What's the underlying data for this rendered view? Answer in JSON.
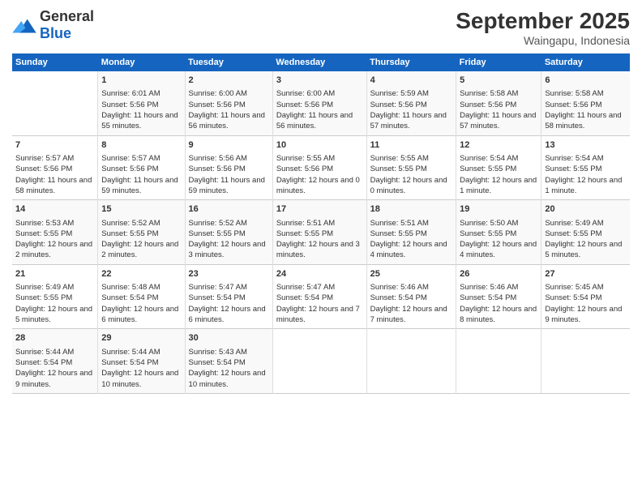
{
  "header": {
    "logo_general": "General",
    "logo_blue": "Blue",
    "title": "September 2025",
    "subtitle": "Waingapu, Indonesia"
  },
  "columns": [
    "Sunday",
    "Monday",
    "Tuesday",
    "Wednesday",
    "Thursday",
    "Friday",
    "Saturday"
  ],
  "weeks": [
    [
      {
        "day": "",
        "sunrise": "",
        "sunset": "",
        "daylight": ""
      },
      {
        "day": "1",
        "sunrise": "Sunrise: 6:01 AM",
        "sunset": "Sunset: 5:56 PM",
        "daylight": "Daylight: 11 hours and 55 minutes."
      },
      {
        "day": "2",
        "sunrise": "Sunrise: 6:00 AM",
        "sunset": "Sunset: 5:56 PM",
        "daylight": "Daylight: 11 hours and 56 minutes."
      },
      {
        "day": "3",
        "sunrise": "Sunrise: 6:00 AM",
        "sunset": "Sunset: 5:56 PM",
        "daylight": "Daylight: 11 hours and 56 minutes."
      },
      {
        "day": "4",
        "sunrise": "Sunrise: 5:59 AM",
        "sunset": "Sunset: 5:56 PM",
        "daylight": "Daylight: 11 hours and 57 minutes."
      },
      {
        "day": "5",
        "sunrise": "Sunrise: 5:58 AM",
        "sunset": "Sunset: 5:56 PM",
        "daylight": "Daylight: 11 hours and 57 minutes."
      },
      {
        "day": "6",
        "sunrise": "Sunrise: 5:58 AM",
        "sunset": "Sunset: 5:56 PM",
        "daylight": "Daylight: 11 hours and 58 minutes."
      }
    ],
    [
      {
        "day": "7",
        "sunrise": "Sunrise: 5:57 AM",
        "sunset": "Sunset: 5:56 PM",
        "daylight": "Daylight: 11 hours and 58 minutes."
      },
      {
        "day": "8",
        "sunrise": "Sunrise: 5:57 AM",
        "sunset": "Sunset: 5:56 PM",
        "daylight": "Daylight: 11 hours and 59 minutes."
      },
      {
        "day": "9",
        "sunrise": "Sunrise: 5:56 AM",
        "sunset": "Sunset: 5:56 PM",
        "daylight": "Daylight: 11 hours and 59 minutes."
      },
      {
        "day": "10",
        "sunrise": "Sunrise: 5:55 AM",
        "sunset": "Sunset: 5:56 PM",
        "daylight": "Daylight: 12 hours and 0 minutes."
      },
      {
        "day": "11",
        "sunrise": "Sunrise: 5:55 AM",
        "sunset": "Sunset: 5:55 PM",
        "daylight": "Daylight: 12 hours and 0 minutes."
      },
      {
        "day": "12",
        "sunrise": "Sunrise: 5:54 AM",
        "sunset": "Sunset: 5:55 PM",
        "daylight": "Daylight: 12 hours and 1 minute."
      },
      {
        "day": "13",
        "sunrise": "Sunrise: 5:54 AM",
        "sunset": "Sunset: 5:55 PM",
        "daylight": "Daylight: 12 hours and 1 minute."
      }
    ],
    [
      {
        "day": "14",
        "sunrise": "Sunrise: 5:53 AM",
        "sunset": "Sunset: 5:55 PM",
        "daylight": "Daylight: 12 hours and 2 minutes."
      },
      {
        "day": "15",
        "sunrise": "Sunrise: 5:52 AM",
        "sunset": "Sunset: 5:55 PM",
        "daylight": "Daylight: 12 hours and 2 minutes."
      },
      {
        "day": "16",
        "sunrise": "Sunrise: 5:52 AM",
        "sunset": "Sunset: 5:55 PM",
        "daylight": "Daylight: 12 hours and 3 minutes."
      },
      {
        "day": "17",
        "sunrise": "Sunrise: 5:51 AM",
        "sunset": "Sunset: 5:55 PM",
        "daylight": "Daylight: 12 hours and 3 minutes."
      },
      {
        "day": "18",
        "sunrise": "Sunrise: 5:51 AM",
        "sunset": "Sunset: 5:55 PM",
        "daylight": "Daylight: 12 hours and 4 minutes."
      },
      {
        "day": "19",
        "sunrise": "Sunrise: 5:50 AM",
        "sunset": "Sunset: 5:55 PM",
        "daylight": "Daylight: 12 hours and 4 minutes."
      },
      {
        "day": "20",
        "sunrise": "Sunrise: 5:49 AM",
        "sunset": "Sunset: 5:55 PM",
        "daylight": "Daylight: 12 hours and 5 minutes."
      }
    ],
    [
      {
        "day": "21",
        "sunrise": "Sunrise: 5:49 AM",
        "sunset": "Sunset: 5:55 PM",
        "daylight": "Daylight: 12 hours and 5 minutes."
      },
      {
        "day": "22",
        "sunrise": "Sunrise: 5:48 AM",
        "sunset": "Sunset: 5:54 PM",
        "daylight": "Daylight: 12 hours and 6 minutes."
      },
      {
        "day": "23",
        "sunrise": "Sunrise: 5:47 AM",
        "sunset": "Sunset: 5:54 PM",
        "daylight": "Daylight: 12 hours and 6 minutes."
      },
      {
        "day": "24",
        "sunrise": "Sunrise: 5:47 AM",
        "sunset": "Sunset: 5:54 PM",
        "daylight": "Daylight: 12 hours and 7 minutes."
      },
      {
        "day": "25",
        "sunrise": "Sunrise: 5:46 AM",
        "sunset": "Sunset: 5:54 PM",
        "daylight": "Daylight: 12 hours and 7 minutes."
      },
      {
        "day": "26",
        "sunrise": "Sunrise: 5:46 AM",
        "sunset": "Sunset: 5:54 PM",
        "daylight": "Daylight: 12 hours and 8 minutes."
      },
      {
        "day": "27",
        "sunrise": "Sunrise: 5:45 AM",
        "sunset": "Sunset: 5:54 PM",
        "daylight": "Daylight: 12 hours and 9 minutes."
      }
    ],
    [
      {
        "day": "28",
        "sunrise": "Sunrise: 5:44 AM",
        "sunset": "Sunset: 5:54 PM",
        "daylight": "Daylight: 12 hours and 9 minutes."
      },
      {
        "day": "29",
        "sunrise": "Sunrise: 5:44 AM",
        "sunset": "Sunset: 5:54 PM",
        "daylight": "Daylight: 12 hours and 10 minutes."
      },
      {
        "day": "30",
        "sunrise": "Sunrise: 5:43 AM",
        "sunset": "Sunset: 5:54 PM",
        "daylight": "Daylight: 12 hours and 10 minutes."
      },
      {
        "day": "",
        "sunrise": "",
        "sunset": "",
        "daylight": ""
      },
      {
        "day": "",
        "sunrise": "",
        "sunset": "",
        "daylight": ""
      },
      {
        "day": "",
        "sunrise": "",
        "sunset": "",
        "daylight": ""
      },
      {
        "day": "",
        "sunrise": "",
        "sunset": "",
        "daylight": ""
      }
    ]
  ]
}
